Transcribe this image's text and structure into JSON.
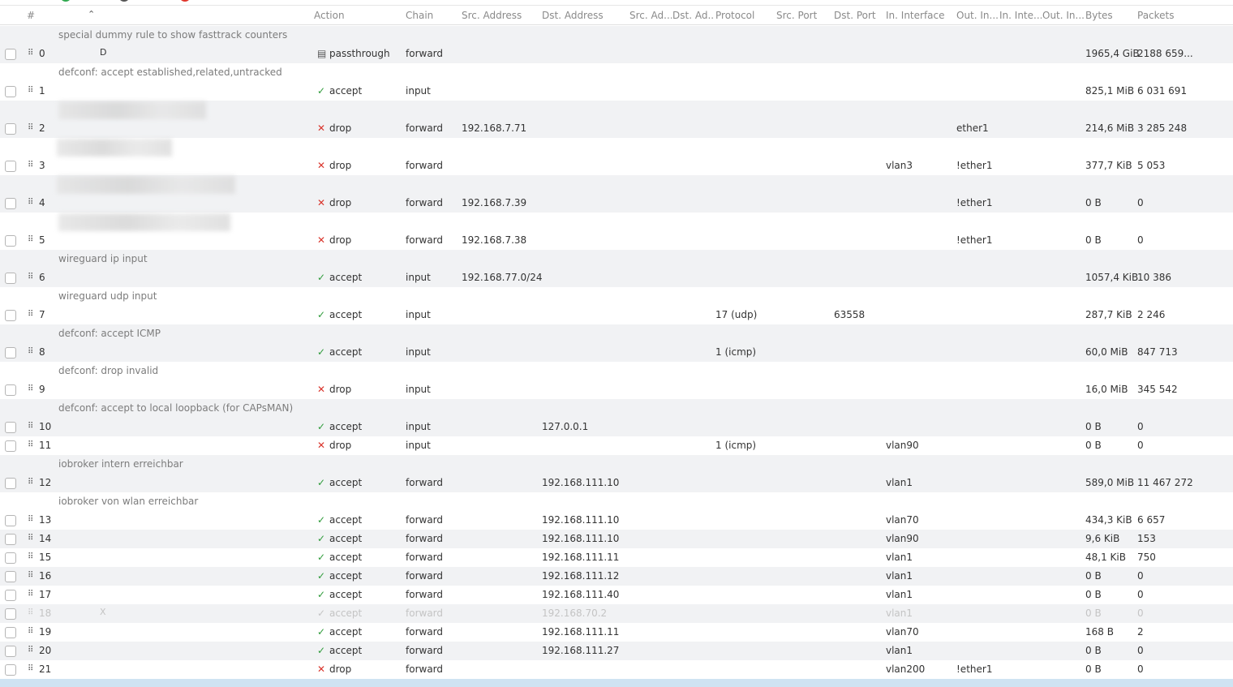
{
  "colors": {
    "accept": "#2e9b3a",
    "drop": "#d9342b",
    "header_text": "#8a8a8a",
    "comment_text": "#7c7c7c",
    "row_alt": "#f1f2f4",
    "selected_row": "#cfe3f2"
  },
  "icons": {
    "accept": "check-icon",
    "drop": "x-icon",
    "passthrough": "document-icon",
    "drag": "drag-handle-icon",
    "sort": "sort-asc-icon"
  },
  "header": {
    "num": "#",
    "action": "Action",
    "chain": "Chain",
    "src_address": "Src. Address",
    "dst_address": "Dst. Address",
    "src_ad": "Src. Ad...",
    "dst_ad": "Dst. Ad...",
    "protocol": "Protocol",
    "src_port": "Src. Port",
    "dst_port": "Dst. Port",
    "in_interface": "In. Interface",
    "out_in": "Out. In...",
    "in_inte": "In. Inte...",
    "out_in2": "Out. In...",
    "bytes": "Bytes",
    "packets": "Packets"
  },
  "rows": [
    {
      "num": "0",
      "flag": "D",
      "comment": "special dummy rule to show fasttrack counters",
      "action": "passthrough",
      "chain": "forward",
      "src": "",
      "dst": "",
      "protocol": "",
      "dst_port": "",
      "in_if": "",
      "out_if": "",
      "bytes": "1965,4 GiB",
      "packets": "2188 659..."
    },
    {
      "num": "1",
      "flag": "",
      "comment": "defconf: accept established,related,untracked",
      "action": "accept",
      "chain": "input",
      "src": "",
      "dst": "",
      "protocol": "",
      "dst_port": "",
      "in_if": "",
      "out_if": "",
      "bytes": "825,1 MiB",
      "packets": "6 031 691"
    },
    {
      "num": "2",
      "flag": "",
      "comment": "",
      "action": "drop",
      "chain": "forward",
      "src": "192.168.7.71",
      "dst": "",
      "protocol": "",
      "dst_port": "",
      "in_if": "",
      "out_if": "ether1",
      "bytes": "214,6 MiB",
      "packets": "3 285 248"
    },
    {
      "num": "3",
      "flag": "",
      "comment": "",
      "action": "drop",
      "chain": "forward",
      "src": "",
      "dst": "",
      "protocol": "",
      "dst_port": "",
      "in_if": "vlan3",
      "out_if": "!ether1",
      "bytes": "377,7 KiB",
      "packets": "5 053"
    },
    {
      "num": "4",
      "flag": "",
      "comment": "",
      "action": "drop",
      "chain": "forward",
      "src": "192.168.7.39",
      "dst": "",
      "protocol": "",
      "dst_port": "",
      "in_if": "",
      "out_if": "!ether1",
      "bytes": "0 B",
      "packets": "0"
    },
    {
      "num": "5",
      "flag": "",
      "comment": "",
      "action": "drop",
      "chain": "forward",
      "src": "192.168.7.38",
      "dst": "",
      "protocol": "",
      "dst_port": "",
      "in_if": "",
      "out_if": "!ether1",
      "bytes": "0 B",
      "packets": "0"
    },
    {
      "num": "6",
      "flag": "",
      "comment": "wireguard ip input",
      "action": "accept",
      "chain": "input",
      "src": "192.168.77.0/24",
      "dst": "",
      "protocol": "",
      "dst_port": "",
      "in_if": "",
      "out_if": "",
      "bytes": "1057,4 KiB",
      "packets": "10 386"
    },
    {
      "num": "7",
      "flag": "",
      "comment": "wireguard udp input",
      "action": "accept",
      "chain": "input",
      "src": "",
      "dst": "",
      "protocol": "17 (udp)",
      "dst_port": "63558",
      "in_if": "",
      "out_if": "",
      "bytes": "287,7 KiB",
      "packets": "2 246"
    },
    {
      "num": "8",
      "flag": "",
      "comment": "defconf: accept ICMP",
      "action": "accept",
      "chain": "input",
      "src": "",
      "dst": "",
      "protocol": "1 (icmp)",
      "dst_port": "",
      "in_if": "",
      "out_if": "",
      "bytes": "60,0 MiB",
      "packets": "847 713"
    },
    {
      "num": "9",
      "flag": "",
      "comment": "defconf: drop invalid",
      "action": "drop",
      "chain": "input",
      "src": "",
      "dst": "",
      "protocol": "",
      "dst_port": "",
      "in_if": "",
      "out_if": "",
      "bytes": "16,0 MiB",
      "packets": "345 542"
    },
    {
      "num": "10",
      "flag": "",
      "comment": "defconf: accept to local loopback (for CAPsMAN)",
      "action": "accept",
      "chain": "input",
      "src": "",
      "dst": "127.0.0.1",
      "protocol": "",
      "dst_port": "",
      "in_if": "",
      "out_if": "",
      "bytes": "0 B",
      "packets": "0"
    },
    {
      "num": "11",
      "flag": "",
      "comment": "",
      "action": "drop",
      "chain": "input",
      "src": "",
      "dst": "",
      "protocol": "1 (icmp)",
      "dst_port": "",
      "in_if": "vlan90",
      "out_if": "",
      "bytes": "0 B",
      "packets": "0"
    },
    {
      "num": "12",
      "flag": "",
      "comment": "iobroker intern erreichbar",
      "action": "accept",
      "chain": "forward",
      "src": "",
      "dst": "192.168.111.10",
      "protocol": "",
      "dst_port": "",
      "in_if": "vlan1",
      "out_if": "",
      "bytes": "589,0 MiB",
      "packets": "11 467 272"
    },
    {
      "num": "13",
      "flag": "",
      "comment": "iobroker von wlan erreichbar",
      "action": "accept",
      "chain": "forward",
      "src": "",
      "dst": "192.168.111.10",
      "protocol": "",
      "dst_port": "",
      "in_if": "vlan70",
      "out_if": "",
      "bytes": "434,3 KiB",
      "packets": "6 657"
    },
    {
      "num": "14",
      "flag": "",
      "comment": "",
      "action": "accept",
      "chain": "forward",
      "src": "",
      "dst": "192.168.111.10",
      "protocol": "",
      "dst_port": "",
      "in_if": "vlan90",
      "out_if": "",
      "bytes": "9,6 KiB",
      "packets": "153"
    },
    {
      "num": "15",
      "flag": "",
      "comment": "",
      "action": "accept",
      "chain": "forward",
      "src": "",
      "dst": "192.168.111.11",
      "protocol": "",
      "dst_port": "",
      "in_if": "vlan1",
      "out_if": "",
      "bytes": "48,1 KiB",
      "packets": "750"
    },
    {
      "num": "16",
      "flag": "",
      "comment": "",
      "action": "accept",
      "chain": "forward",
      "src": "",
      "dst": "192.168.111.12",
      "protocol": "",
      "dst_port": "",
      "in_if": "vlan1",
      "out_if": "",
      "bytes": "0 B",
      "packets": "0"
    },
    {
      "num": "17",
      "flag": "",
      "comment": "",
      "action": "accept",
      "chain": "forward",
      "src": "",
      "dst": "192.168.111.40",
      "protocol": "",
      "dst_port": "",
      "in_if": "vlan1",
      "out_if": "",
      "bytes": "0 B",
      "packets": "0"
    },
    {
      "num": "18",
      "flag": "X",
      "comment": "",
      "action": "accept",
      "chain": "forward",
      "src": "",
      "dst": "192.168.70.2",
      "protocol": "",
      "dst_port": "",
      "in_if": "vlan1",
      "out_if": "",
      "bytes": "0 B",
      "packets": "0"
    },
    {
      "num": "19",
      "flag": "",
      "comment": "",
      "action": "accept",
      "chain": "forward",
      "src": "",
      "dst": "192.168.111.11",
      "protocol": "",
      "dst_port": "",
      "in_if": "vlan70",
      "out_if": "",
      "bytes": "168 B",
      "packets": "2"
    },
    {
      "num": "20",
      "flag": "",
      "comment": "",
      "action": "accept",
      "chain": "forward",
      "src": "",
      "dst": "192.168.111.27",
      "protocol": "",
      "dst_port": "",
      "in_if": "vlan1",
      "out_if": "",
      "bytes": "0 B",
      "packets": "0"
    },
    {
      "num": "21",
      "flag": "",
      "comment": "",
      "action": "drop",
      "chain": "forward",
      "src": "",
      "dst": "",
      "protocol": "",
      "dst_port": "",
      "in_if": "vlan200",
      "out_if": "!ether1",
      "bytes": "0 B",
      "packets": "0"
    }
  ]
}
